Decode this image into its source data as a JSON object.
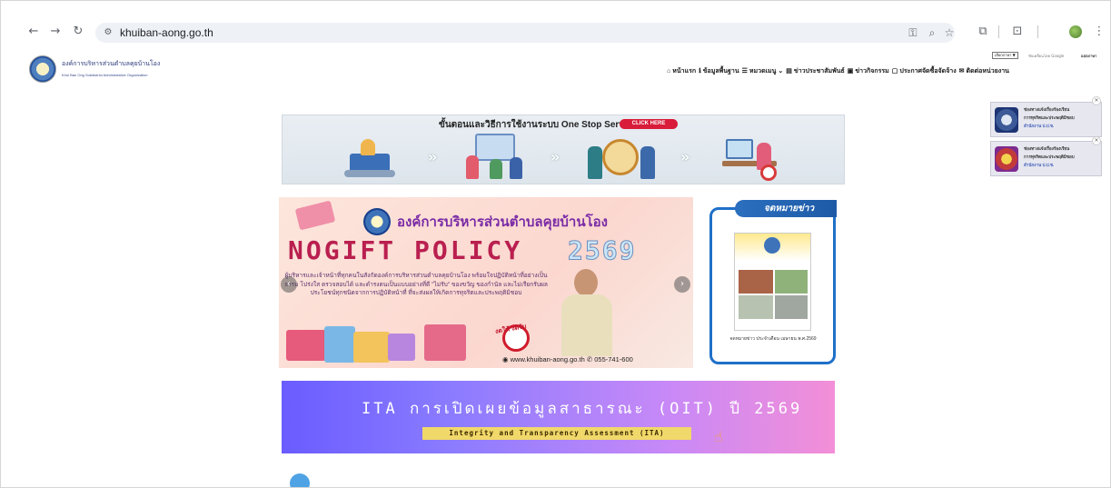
{
  "browser": {
    "url": "khuiban-aong.go.th",
    "icons": {
      "back": "arrow-left-icon",
      "forward": "arrow-right-icon",
      "reload": "reload-icon",
      "site_info": "tune-icon",
      "password": "key-icon",
      "zoom": "zoom-icon",
      "bookmark": "star-icon",
      "extensions": "puzzle-icon",
      "tab_search": "tab-search-icon",
      "profile": "profile-avatar",
      "menu": "kebab-menu-icon"
    }
  },
  "header": {
    "org_name_th": "องค์การบริหารส่วนตำบลคุยบ้านโอง",
    "org_name_en": "Khui Ban Ong Subdistrict Administrative Organization",
    "translate": {
      "select_label": "เลือกภาษา ▼",
      "powered": "ขับเคลื่อนโดย Google",
      "label": "แปลภาษา"
    },
    "nav": [
      {
        "label": "หน้าแรก",
        "icon": "home-icon",
        "glyph": "⌂"
      },
      {
        "label": "ข้อมูลพื้นฐาน",
        "icon": "info-icon",
        "glyph": "ℹ"
      },
      {
        "label": "หมวดเมนู",
        "icon": "menu-book-icon",
        "glyph": "☰",
        "dropdown": "⌄"
      },
      {
        "label": "ข่าวประชาสัมพันธ์",
        "icon": "news-icon",
        "glyph": "▤"
      },
      {
        "label": "ข่าวกิจกรรม",
        "icon": "image-icon",
        "glyph": "▣"
      },
      {
        "label": "ประกาศจัดซื้อจัดจ้าง",
        "icon": "clipboard-icon",
        "glyph": "▢"
      },
      {
        "label": "ติดต่อหน่วยงาน",
        "icon": "mail-icon",
        "glyph": "✉"
      }
    ]
  },
  "oss_banner": {
    "title": "ขั้นตอนและวิธีการใช้งานระบบ One Stop Service",
    "cta": "CLICK HERE"
  },
  "gift_slider": {
    "org": "องค์การบริหารส่วนตำบลคุยบ้านโอง",
    "policy": "NOGIFT POLICY",
    "year": "2569",
    "body": "ผู้บริหารและเจ้าหน้าที่ทุกคนในสังกัดองค์การบริหารส่วนตำบลคุยบ้านโอง พร้อมใจปฏิบัติหน้าที่อย่างเป็นธรรม โปร่งใส ตรวจสอบได้ และดำรงตนเป็นแบบอย่างที่ดี \"ไม่รับ\" ของขวัญ ของกำนัล และไม่เรียกรับผลประโยชน์ทุกชนิดจากการปฏิบัติหน้าที่ ที่จะส่งผลให้เกิดการทุจริตและประพฤติมิชอบ",
    "stamp": "งดให้ งดรับ",
    "website": "www.khuiban-aong.go.th",
    "phone": "055-741-600",
    "prev": "‹",
    "next": "›"
  },
  "newsletter": {
    "tag": "จดหมายข่าว",
    "caption": "จดหมายข่าว ประจำเดือน เมษายน พ.ศ.2569"
  },
  "ita": {
    "title": "ITA การเปิดเผยข้อมูลสาธารณะ (OIT) ปี 2569",
    "subtitle": "Integrity and Transparency Assessment (ITA)"
  },
  "side_widgets": [
    {
      "line1": "ช่องทางแจ้งเรื่องร้องเรียน",
      "line2": "การทุจริตและประพฤติมิชอบ",
      "line3": "สำนักงาน ป.ป.ช.",
      "close": "×"
    },
    {
      "line1": "ช่องทางแจ้งเรื่องร้องเรียน",
      "line2": "การทุจริตและประพฤติมิชอบ",
      "line3": "สำนักงาน ป.ป.ช.",
      "close": "×"
    }
  ]
}
